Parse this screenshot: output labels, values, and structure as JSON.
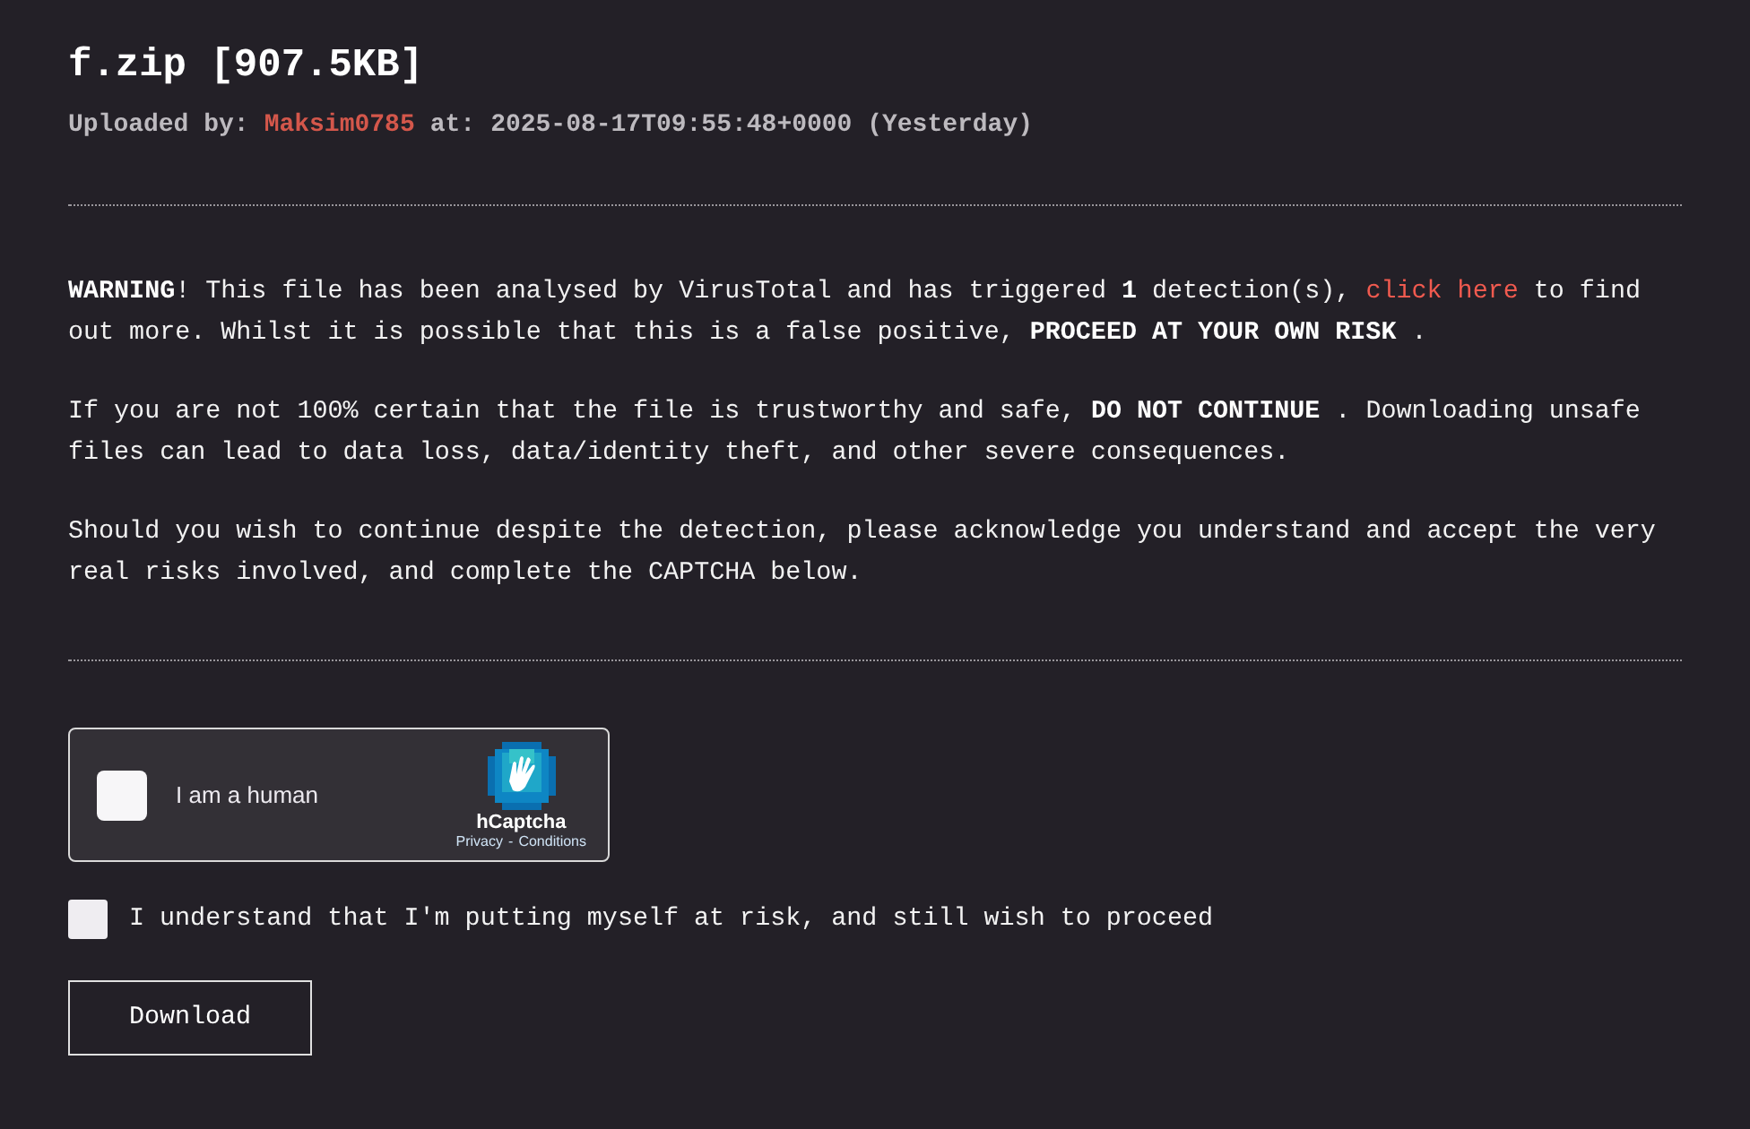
{
  "file": {
    "title": "f.zip [907.5KB]",
    "uploaded_label": "Uploaded by:",
    "uploader": "Maksim0785",
    "at_label": "at:",
    "timestamp": "2025-08-17T09:55:48+0000 (Yesterday)"
  },
  "warning": [
    {
      "before": "**WARNING**! This file has been analysed by VirusTotal and has triggered **1** detection(s), ",
      "link": "click here",
      "after": " to find out more. Whilst it is possible that this is a false positive, **PROCEED AT YOUR OWN RISK** ."
    },
    {
      "before": "If you are not 100% certain that the file is trustworthy and safe, **DO NOT CONTINUE** . Downloading unsafe files can lead to data loss, data/identity theft, and other severe consequences."
    },
    {
      "before": "Should you wish to continue despite the detection, please acknowledge you understand and accept the very real risks involved, and complete the CAPTCHA below."
    }
  ],
  "captcha": {
    "checked": false,
    "label": "I am a human",
    "brand": "hCaptcha",
    "privacy": "Privacy",
    "separator": "-",
    "conditions": "Conditions"
  },
  "acknowledge": {
    "checked": false,
    "label": "I understand that I'm putting myself at risk, and still wish to proceed"
  },
  "download_button": "Download"
}
